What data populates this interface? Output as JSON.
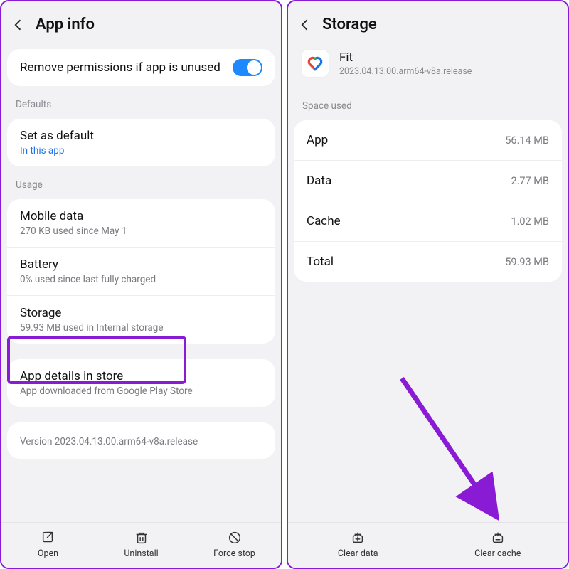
{
  "left": {
    "title": "App info",
    "removePerm": "Remove permissions if app is unused",
    "sections": {
      "defaults": "Defaults",
      "usage": "Usage"
    },
    "setDefault": {
      "title": "Set as default",
      "sub": "In this app"
    },
    "mobileData": {
      "title": "Mobile data",
      "sub": "270 KB used since May 1"
    },
    "battery": {
      "title": "Battery",
      "sub": "0% used since last fully charged"
    },
    "storage": {
      "title": "Storage",
      "sub": "59.93 MB used in Internal storage"
    },
    "appDetails": {
      "title": "App details in store",
      "sub": "App downloaded from Google Play Store"
    },
    "version": "Version 2023.04.13.00.arm64-v8a.release",
    "bottom": {
      "open": "Open",
      "uninstall": "Uninstall",
      "forceStop": "Force stop"
    }
  },
  "right": {
    "title": "Storage",
    "app": {
      "name": "Fit",
      "version": "2023.04.13.00.arm64-v8a.release"
    },
    "spaceUsedLabel": "Space used",
    "rows": {
      "app": {
        "k": "App",
        "v": "56.14 MB"
      },
      "data": {
        "k": "Data",
        "v": "2.77 MB"
      },
      "cache": {
        "k": "Cache",
        "v": "1.02 MB"
      },
      "total": {
        "k": "Total",
        "v": "59.93 MB"
      }
    },
    "bottom": {
      "clearData": "Clear data",
      "clearCache": "Clear cache"
    }
  }
}
